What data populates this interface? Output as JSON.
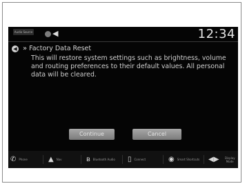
{
  "status_bar": {
    "audio_source_label": "Audio Source",
    "clock": "12:34",
    "icons": [
      "settings-icon",
      "volume-icon"
    ]
  },
  "dialog": {
    "title": "Factory Data Reset",
    "breadcrumb_glyph": "»",
    "message": "This will restore system settings such as brightness, volume and routing preferences to their default values. All personal data will be cleared.",
    "continue_label": "Continue",
    "cancel_label": "Cancel"
  },
  "bottom_bar": {
    "items": [
      {
        "label": "Phone",
        "icon": "phone-icon"
      },
      {
        "label": "Nav",
        "icon": "navigation-icon"
      },
      {
        "label": "Bluetooth Audio",
        "icon": "bluetooth-icon"
      },
      {
        "label": "Connect",
        "icon": "connect-icon"
      },
      {
        "label": "Smart Shortcuts",
        "icon": "shortcuts-icon"
      },
      {
        "label": "Display Mode",
        "icon": "display-mode-icon"
      }
    ]
  },
  "colors": {
    "screen_bg": "#050505",
    "text": "#cfcfcf",
    "button": "#8f8f8f"
  }
}
